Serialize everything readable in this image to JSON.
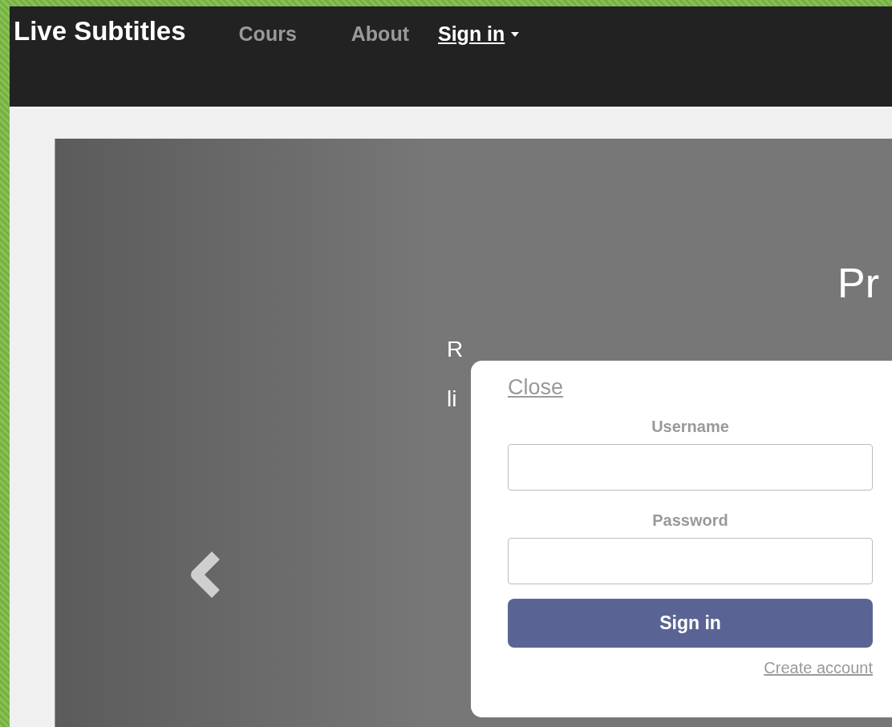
{
  "navbar": {
    "brand": "Live Subtitles",
    "links": [
      {
        "label": "Cours",
        "kind": "plain"
      },
      {
        "label": "About",
        "kind": "plain"
      },
      {
        "label": "Sign in",
        "kind": "dropdown"
      }
    ]
  },
  "carousel": {
    "heading": "Pr",
    "caption_lines": [
      "R",
      "li"
    ]
  },
  "signin_popup": {
    "close": "Close",
    "fields": [
      {
        "label": "Username"
      },
      {
        "label": "Password"
      }
    ],
    "submit": "Sign in",
    "create_account": "Create account"
  }
}
